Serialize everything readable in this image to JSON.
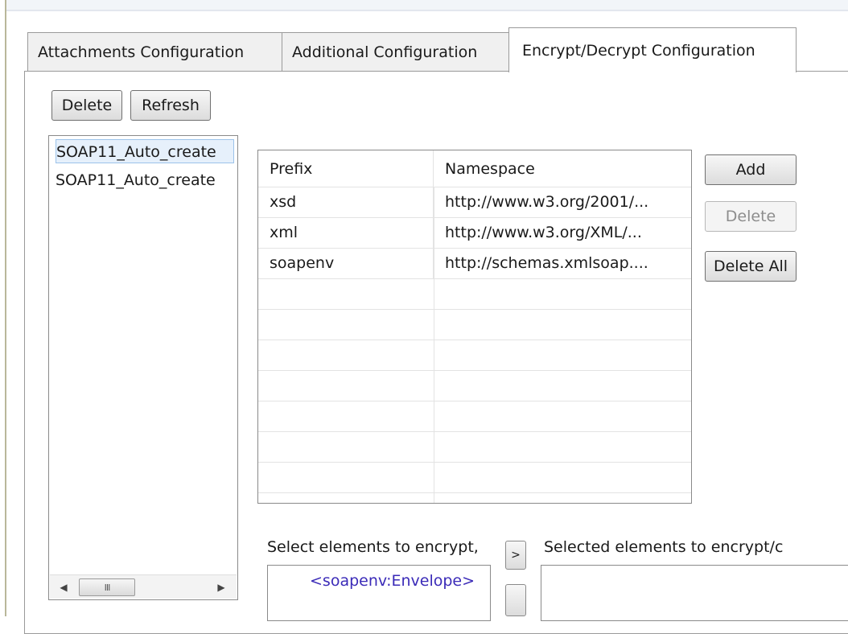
{
  "tabs": [
    {
      "label": "Attachments Configuration"
    },
    {
      "label": "Additional Configuration"
    },
    {
      "label": "Encrypt/Decrypt Configuration"
    }
  ],
  "toolbar": {
    "delete_label": "Delete",
    "refresh_label": "Refresh"
  },
  "config_list": {
    "items": [
      {
        "label": "SOAP11_Auto_create"
      },
      {
        "label": "SOAP11_Auto_create"
      }
    ],
    "scroll_left_icon": "◀",
    "scroll_right_icon": "▶",
    "scroll_grip": "III"
  },
  "namespaces": {
    "columns": [
      "Prefix",
      "Namespace"
    ],
    "rows": [
      {
        "prefix": "xsd",
        "namespace": "http://www.w3.org/2001/..."
      },
      {
        "prefix": "xml",
        "namespace": "http://www.w3.org/XML/..."
      },
      {
        "prefix": "soapenv",
        "namespace": "http://schemas.xmlsoap...."
      }
    ]
  },
  "ns_buttons": {
    "add_label": "Add",
    "delete_label": "Delete",
    "delete_all_label": "Delete All"
  },
  "encrypt": {
    "select_label": "Select elements to encrypt,",
    "selected_label": "Selected elements to encrypt/c",
    "move_right_label": ">",
    "tree_item": "<soapenv:Envelope>"
  }
}
